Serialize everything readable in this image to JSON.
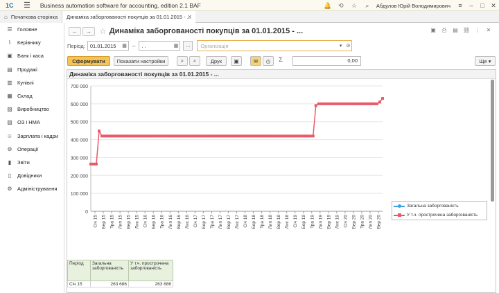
{
  "titlebar": {
    "logo": "1С",
    "app_title": "Business automation software for accounting, edition 2.1 BAF",
    "user": "Абдулов Юрій Володимирович"
  },
  "tabs": [
    {
      "label": "Початкова сторінка"
    },
    {
      "label": "Динаміка заборгованості покупців за 01.01.2015 - ..."
    }
  ],
  "sidebar": {
    "items": [
      {
        "label": "Головне",
        "icon": "menu-icon"
      },
      {
        "label": "Керівнику",
        "icon": "trend-icon"
      },
      {
        "label": "Банк і каса",
        "icon": "bank-icon"
      },
      {
        "label": "Продажі",
        "icon": "cart-icon"
      },
      {
        "label": "Купівлі",
        "icon": "basket-icon"
      },
      {
        "label": "Склад",
        "icon": "warehouse-icon"
      },
      {
        "label": "Виробництво",
        "icon": "factory-icon"
      },
      {
        "label": "ОЗ і НМА",
        "icon": "truck-icon"
      },
      {
        "label": "Зарплата і кадри",
        "icon": "people-icon"
      },
      {
        "label": "Операції",
        "icon": "operations-icon"
      },
      {
        "label": "Звіти",
        "icon": "reports-icon"
      },
      {
        "label": "Довідники",
        "icon": "book-icon"
      },
      {
        "label": "Адміністрування",
        "icon": "gear-icon"
      }
    ]
  },
  "document": {
    "title": "Динаміка заборгованості покупців за 01.01.2015 - ..."
  },
  "period": {
    "label": "Період:",
    "from_value": "01.01.2015",
    "to_value": " . .",
    "dash": "–",
    "more_button": "...",
    "organization_placeholder": "Організація"
  },
  "commands": {
    "generate_label": "Сформувати",
    "settings_label": "Показати настройки",
    "print_label": "Друк",
    "sigma": "Σ",
    "sum_value": "0,00",
    "more_label": "Ще"
  },
  "report": {
    "title": "Динаміка заборгованості покупців за 01.01.2015 - ...",
    "table": {
      "headers": [
        "Період",
        "Загальна заборгованість",
        "У т.ч. прострочена заборгованість"
      ],
      "rows": [
        [
          "Січ 15",
          "263 686",
          "263 686"
        ]
      ]
    }
  },
  "chart_data": {
    "type": "line",
    "ylim": [
      0,
      700000
    ],
    "yticks": [
      "0",
      "100 000",
      "200 000",
      "300 000",
      "400 000",
      "500 000",
      "600 000",
      "700 000"
    ],
    "x": [
      "Січ 15",
      "Бер 15",
      "Тра 15",
      "Лип 15",
      "Вер 15",
      "Лис 15",
      "Січ 16",
      "Бер 16",
      "Тра 16",
      "Лип 16",
      "Вер 16",
      "Лис 16",
      "Січ 17",
      "Бер 17",
      "Тра 17",
      "Лип 17",
      "Вер 17",
      "Лис 17",
      "Січ 18",
      "Бер 18",
      "Тра 18",
      "Лип 18",
      "Вер 18",
      "Лис 18",
      "Січ 19",
      "Бер 19",
      "Тра 19",
      "Лип 19",
      "Вер 19",
      "Лис 19",
      "Січ 20",
      "Бер 20",
      "Тра 20",
      "Лип 20",
      "Вер 20"
    ],
    "series": [
      {
        "name": "Загальна заборгованість",
        "color": "#3aa2e0",
        "values": []
      },
      {
        "name": "У т.ч. прострочена заборгованість",
        "color": "#e85a66",
        "values": [
          263686,
          263686,
          263686,
          448000,
          420000,
          420000,
          420000,
          420000,
          420000,
          420000,
          420000,
          420000,
          420000,
          420000,
          420000,
          420000,
          420000,
          420000,
          420000,
          420000,
          420000,
          420000,
          420000,
          420000,
          420000,
          420000,
          420000,
          420000,
          420000,
          420000,
          420000,
          420000,
          420000,
          420000,
          420000,
          420000,
          420000,
          420000,
          420000,
          420000,
          420000,
          420000,
          420000,
          420000,
          420000,
          420000,
          420000,
          420000,
          420000,
          420000,
          420000,
          420000,
          420000,
          420000,
          420000,
          420000,
          420000,
          420000,
          420000,
          420000,
          420000,
          420000,
          420000,
          420000,
          420000,
          420000,
          420000,
          420000,
          420000,
          420000,
          420000,
          420000,
          420000,
          420000,
          420000,
          420000,
          420000,
          420000,
          420000,
          420000,
          420000,
          590000,
          600000,
          600000,
          600000,
          600000,
          600000,
          600000,
          600000,
          600000,
          600000,
          600000,
          600000,
          600000,
          600000,
          600000,
          600000,
          600000,
          600000,
          600000,
          600000,
          600000,
          600000,
          600000,
          610000,
          630000
        ]
      }
    ],
    "legend": "right"
  }
}
